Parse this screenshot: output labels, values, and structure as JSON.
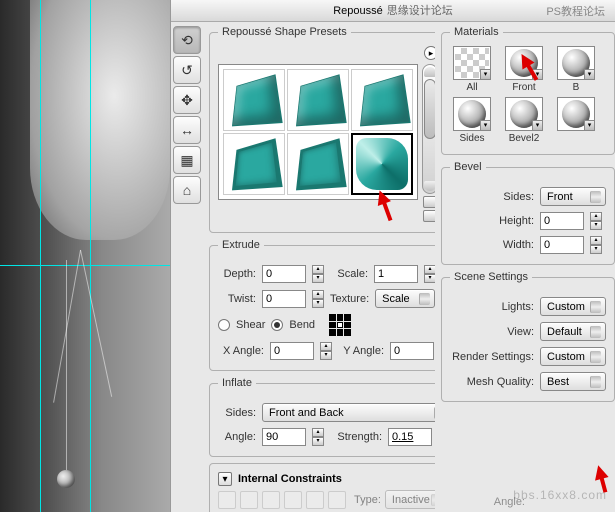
{
  "title_bar": {
    "title": "Repoussé",
    "overlay": "思缘设计论坛"
  },
  "watermark": {
    "tr": "PS教程论坛",
    "br": "bbs.16xx8.com"
  },
  "presets": {
    "legend": "Repoussé Shape Presets"
  },
  "extrude": {
    "legend": "Extrude",
    "depth_label": "Depth:",
    "depth": "0",
    "scale_label": "Scale:",
    "scale": "1",
    "twist_label": "Twist:",
    "twist": "0",
    "texture_label": "Texture:",
    "texture": "Scale",
    "shear_label": "Shear",
    "bend_label": "Bend",
    "xangle_label": "X Angle:",
    "xangle": "0",
    "yangle_label": "Y Angle:",
    "yangle": "0"
  },
  "inflate": {
    "legend": "Inflate",
    "sides_label": "Sides:",
    "sides": "Front and Back",
    "angle_label": "Angle:",
    "angle": "90",
    "strength_label": "Strength:",
    "strength": "0.15"
  },
  "internal": {
    "legend": "Internal Constraints",
    "type_label": "Type:",
    "type": "Inactive",
    "angle_label": "Angle:"
  },
  "materials": {
    "legend": "Materials",
    "all": "All",
    "front": "Front",
    "b": "B",
    "sides": "Sides",
    "bevel2": "Bevel2"
  },
  "bevel": {
    "legend": "Bevel",
    "sides_label": "Sides:",
    "sides": "Front",
    "height_label": "Height:",
    "height": "0",
    "width_label": "Width:",
    "width": "0"
  },
  "scene": {
    "legend": "Scene Settings",
    "lights_label": "Lights:",
    "lights": "Custom",
    "view_label": "View:",
    "view": "Default",
    "render_label": "Render Settings:",
    "render": "Custom",
    "mesh_label": "Mesh Quality:",
    "mesh": "Best"
  }
}
